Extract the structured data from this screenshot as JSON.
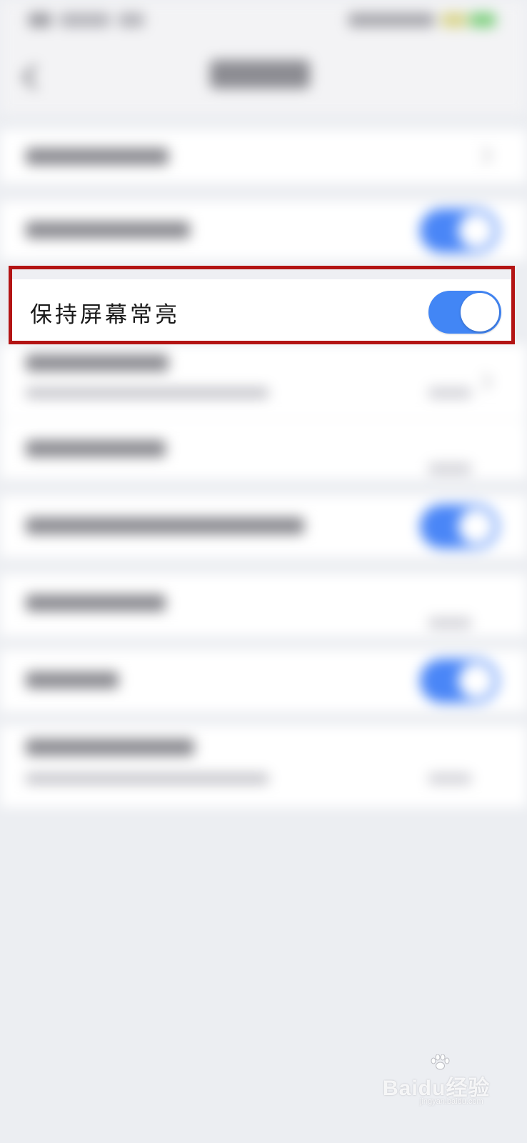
{
  "highlighted_setting": {
    "label": "保持屏幕常亮",
    "toggle_state": "on"
  },
  "colors": {
    "highlight_border": "#b31414",
    "toggle_on": "#4286f5",
    "page_background": "#eceef2"
  },
  "watermark": {
    "brand": "Baidu经验",
    "url": "jingyan.baidu.com"
  },
  "icons": {
    "back": "back-chevron-icon",
    "watermark_logo": "baidu-paw-icon"
  }
}
